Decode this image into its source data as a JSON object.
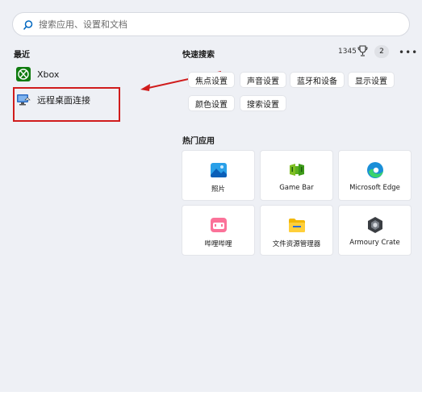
{
  "search": {
    "placeholder": "搜索应用、设置和文档"
  },
  "recent": {
    "title": "最近",
    "items": [
      {
        "label": "Xbox",
        "icon": "xbox-icon"
      },
      {
        "label": "远程桌面连接",
        "icon": "remote-desktop-icon"
      }
    ]
  },
  "quick_search": {
    "title": "快速搜索",
    "points": "1345",
    "points_icon": "rewards-trophy-icon",
    "badge": "2",
    "more_icon": "more-icon",
    "chips": [
      "焦点设置",
      "声音设置",
      "蓝牙和设备",
      "显示设置",
      "颜色设置",
      "搜索设置"
    ]
  },
  "hot_apps": {
    "title": "热门应用",
    "tiles": [
      {
        "label": "照片",
        "icon": "photos-icon"
      },
      {
        "label": "Game Bar",
        "icon": "game-bar-icon"
      },
      {
        "label": "Microsoft Edge",
        "icon": "edge-icon"
      },
      {
        "label": "哔哩哔哩",
        "icon": "bilibili-icon"
      },
      {
        "label": "文件资源管理器",
        "icon": "file-explorer-icon"
      },
      {
        "label": "Armoury Crate",
        "icon": "armoury-crate-icon"
      }
    ]
  },
  "colors": {
    "accent": "#0067c0",
    "annotation": "#d01c1c"
  }
}
